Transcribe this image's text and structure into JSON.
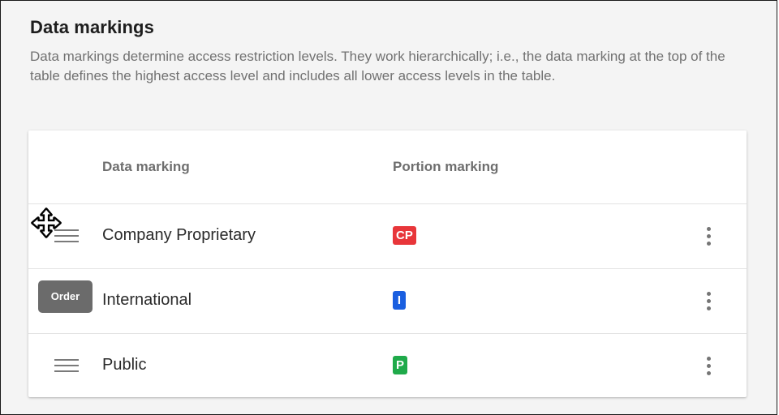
{
  "section": {
    "title": "Data markings",
    "description": "Data markings determine access restriction levels. They work hierarchically; i.e., the data marking at the top of the table defines the highest access level and includes all lower access levels in the table."
  },
  "table": {
    "columns": {
      "data_marking": "Data marking",
      "portion_marking": "Portion marking"
    },
    "rows": [
      {
        "name": "Company Proprietary",
        "portion": "CP",
        "portion_color": "#e8363a"
      },
      {
        "name": "International",
        "portion": "I",
        "portion_color": "#1a5fe0"
      },
      {
        "name": "Public",
        "portion": "P",
        "portion_color": "#1faa4a"
      }
    ]
  },
  "drag_tooltip": "Order",
  "icons": {
    "drag_handle": "drag-handle-icon",
    "more": "more-vert-icon",
    "cursor": "move-cursor-icon"
  }
}
